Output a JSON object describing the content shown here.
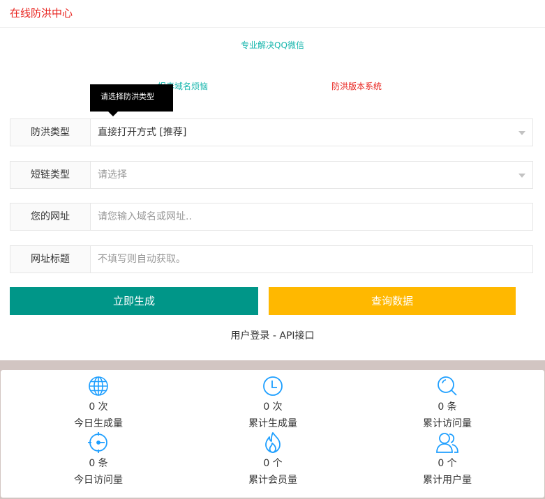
{
  "header": {
    "title": "在线防洪中心"
  },
  "promo": {
    "line1": "专业解决QQ微信",
    "line2": "报毒域名烦恼",
    "line3": "防洪版本系统"
  },
  "tooltip": {
    "text": "请选择防洪类型"
  },
  "form": {
    "type": {
      "label": "防洪类型",
      "value": "直接打开方式 [推荐]"
    },
    "short": {
      "label": "短链类型",
      "placeholder": "请选择"
    },
    "url": {
      "label": "您的网址",
      "placeholder": "请您输入域名或网址.."
    },
    "title": {
      "label": "网址标题",
      "placeholder": "不填写则自动获取。"
    }
  },
  "buttons": {
    "generate": "立即生成",
    "query": "查询数据"
  },
  "links": {
    "login": "用户登录",
    "sep": " - ",
    "api": "API接口"
  },
  "stats": [
    {
      "icon": "globe-icon",
      "value": "0 次",
      "label": "今日生成量"
    },
    {
      "icon": "clock-icon",
      "value": "0 次",
      "label": "累计生成量"
    },
    {
      "icon": "search-icon",
      "value": "0 条",
      "label": "累计访问量"
    },
    {
      "icon": "speedometer-icon",
      "value": "0 条",
      "label": "今日访问量"
    },
    {
      "icon": "fire-icon",
      "value": "0 个",
      "label": "累计会员量"
    },
    {
      "icon": "users-icon",
      "value": "0 个",
      "label": "累计用户量"
    }
  ],
  "colors": {
    "title_red": "#e8211c",
    "teal": "#17b6ad",
    "green_btn": "#009688",
    "yellow_btn": "#ffb800",
    "icon_blue": "#1e9fff"
  }
}
